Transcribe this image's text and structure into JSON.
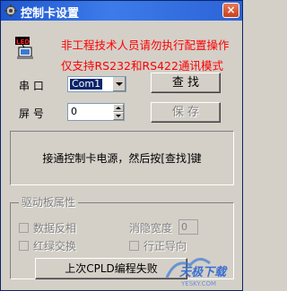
{
  "window": {
    "title": "控制卡设置",
    "close_label": "×"
  },
  "notice": {
    "line1": "非工程技术人员请勿执行配置操作",
    "line2": "仅支持RS232和RS422通讯模式"
  },
  "serial": {
    "label": "串  口",
    "value": "Com1"
  },
  "screen": {
    "label": "屏  号",
    "value": "0"
  },
  "buttons": {
    "search": "查  找",
    "save": "保  存",
    "cpld": "上次CPLD编程失败"
  },
  "message": "接通控制卡电源，然后按[查找]键",
  "driver_group": {
    "title": "驱动板属性",
    "invert": "数据反相",
    "swap": "红绿交换",
    "blank_width_label": "消隐宽度",
    "blank_width_value": "0",
    "row_order": "行正导向"
  },
  "watermark": {
    "text": "天极下载",
    "domain": "YESKY.COM"
  },
  "colors": {
    "title_bar": "#2b63d6",
    "notice": "#ff0000",
    "face": "#d4d0c8"
  },
  "icons": {
    "title": "gear-icon",
    "led": "led-device-icon"
  }
}
